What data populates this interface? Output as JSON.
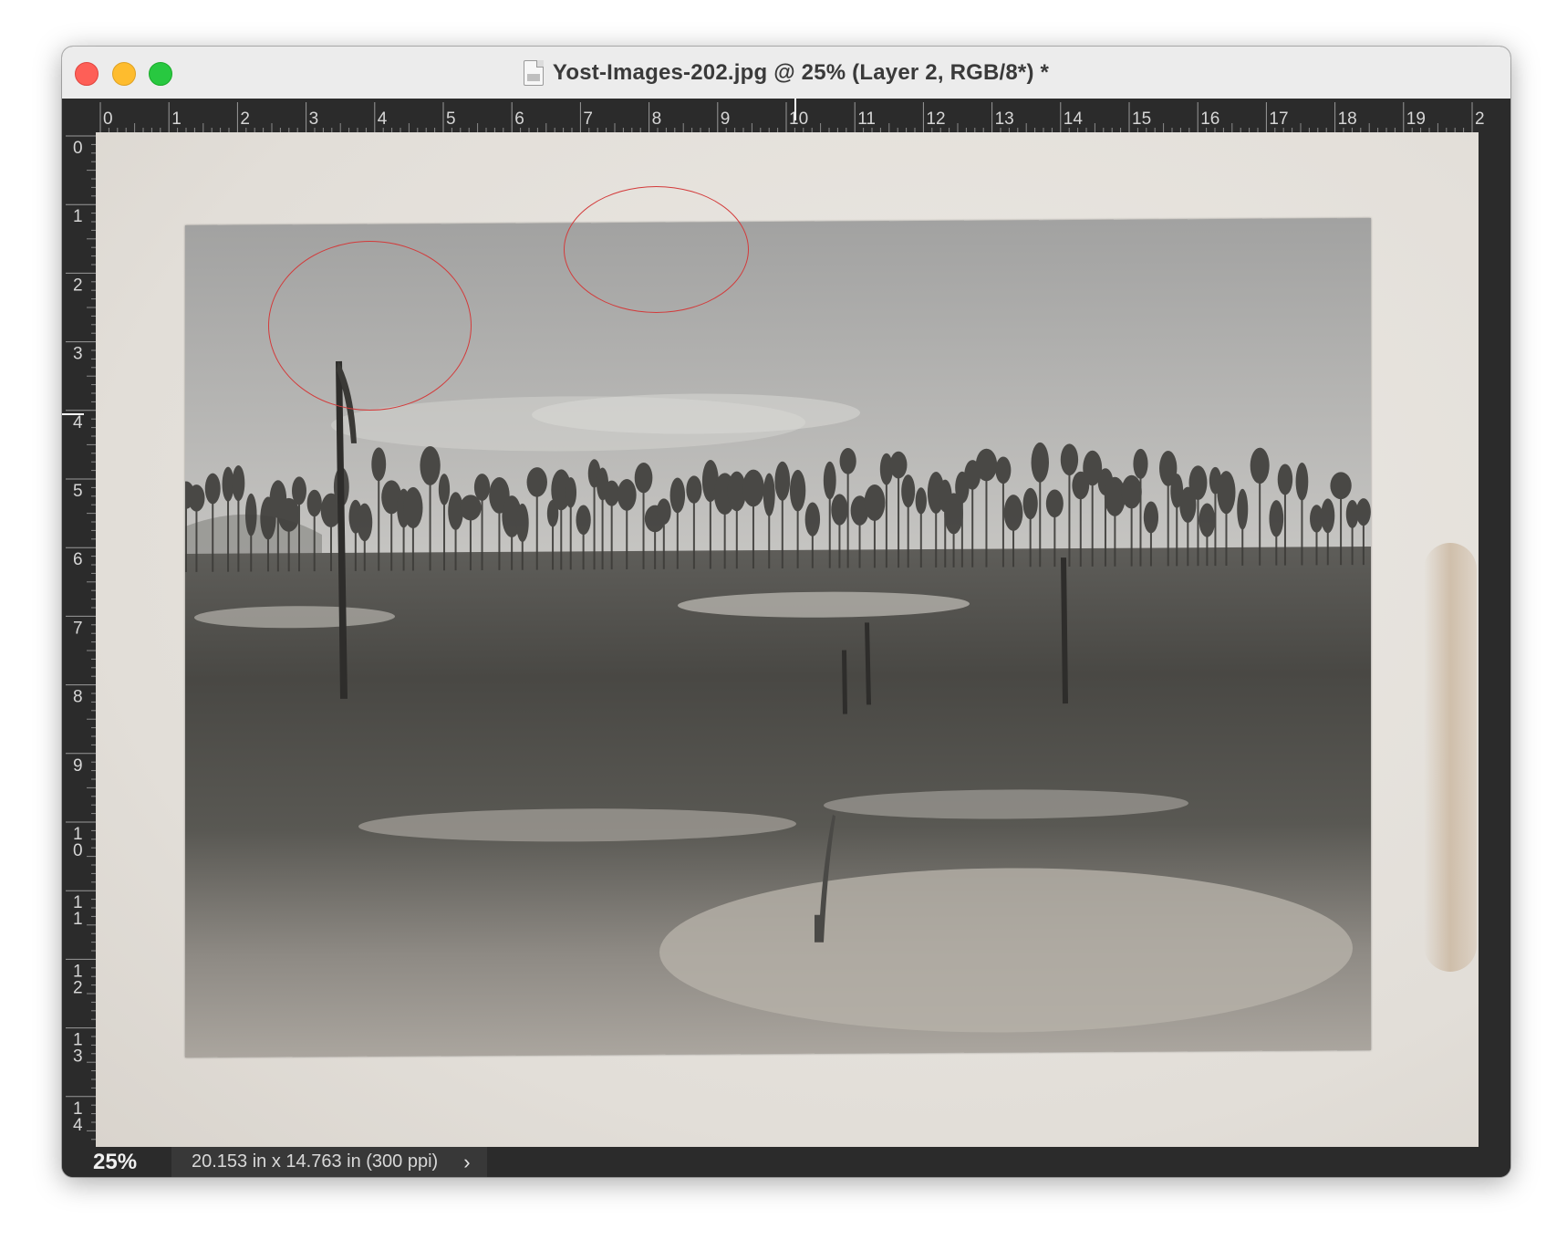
{
  "window": {
    "title": "Yost-Images-202.jpg @ 25% (Layer 2, RGB/8*) *",
    "file_icon": "jpg-file-icon"
  },
  "rulers": {
    "top_labels": [
      "0",
      "1",
      "2",
      "3",
      "4",
      "5",
      "6",
      "7",
      "8",
      "9",
      "10",
      "11",
      "12",
      "13",
      "14",
      "15",
      "16",
      "17",
      "18",
      "19",
      "2"
    ],
    "left_labels": [
      "0",
      "1",
      "2",
      "3",
      "4",
      "5",
      "6",
      "7",
      "8",
      "9",
      "1\n0",
      "1\n1",
      "1\n2",
      "1\n3",
      "1\n4"
    ]
  },
  "statusbar": {
    "zoom": "25%",
    "doc_size": "20.153 in x 14.763 in (300 ppi)",
    "menu_arrow": "›"
  },
  "annotations": {
    "circle_color": "#d33a3a"
  }
}
